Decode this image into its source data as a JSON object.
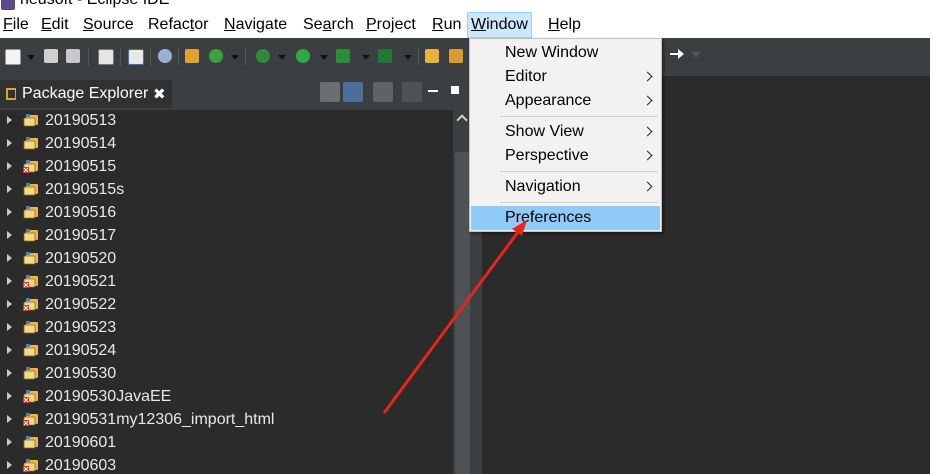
{
  "window": {
    "title": "neusoft - Eclipse IDE"
  },
  "menubar": {
    "items": [
      {
        "label": "File",
        "mnemonic": "F",
        "rest": "ile"
      },
      {
        "label": "Edit",
        "mnemonic": "E",
        "rest": "dit"
      },
      {
        "label": "Source",
        "mnemonic": "S",
        "rest": "ource"
      },
      {
        "label": "Refactor",
        "pre": "Refac",
        "mnemonic": "t",
        "rest": "or"
      },
      {
        "label": "Navigate",
        "mnemonic": "N",
        "rest": "avigate"
      },
      {
        "label": "Search",
        "pre": "Se",
        "mnemonic": "a",
        "rest": "rch"
      },
      {
        "label": "Project",
        "mnemonic": "P",
        "rest": "roject"
      },
      {
        "label": "Run",
        "mnemonic": "R",
        "rest": "un"
      },
      {
        "label": "Window",
        "mnemonic": "W",
        "rest": "indow"
      },
      {
        "label": "Help",
        "mnemonic": "H",
        "rest": "elp"
      }
    ],
    "active": "Window"
  },
  "window_menu": {
    "items": [
      {
        "label": "New Window",
        "submenu": false
      },
      {
        "label": "Editor",
        "submenu": true
      },
      {
        "label": "Appearance",
        "submenu": true
      },
      {
        "label": "Show View",
        "submenu": true
      },
      {
        "label": "Perspective",
        "submenu": true
      },
      {
        "label": "Navigation",
        "submenu": true
      },
      {
        "label": "Preferences",
        "submenu": false,
        "highlighted": true
      }
    ]
  },
  "package_explorer": {
    "title": "Package Explorer",
    "close_icon": "close-icon",
    "projects": [
      {
        "name": "20190513",
        "error": false
      },
      {
        "name": "20190514",
        "error": false
      },
      {
        "name": "20190515",
        "error": true
      },
      {
        "name": "20190515s",
        "error": false
      },
      {
        "name": "20190516",
        "error": false
      },
      {
        "name": "20190517",
        "error": false
      },
      {
        "name": "20190520",
        "error": false
      },
      {
        "name": "20190521",
        "error": true
      },
      {
        "name": "20190522",
        "error": true
      },
      {
        "name": "20190523",
        "error": false
      },
      {
        "name": "20190524",
        "error": false
      },
      {
        "name": "20190530",
        "error": false
      },
      {
        "name": "20190530JavaEE",
        "error": true
      },
      {
        "name": "20190531my12306_import_html",
        "error": true
      },
      {
        "name": "20190601",
        "error": false
      },
      {
        "name": "20190603",
        "error": true
      }
    ]
  },
  "colors": {
    "background": "#2b2b2b",
    "menu_highlight": "#91c9f7",
    "active_menubar": "#cce8ff",
    "annotation_arrow": "#e8241c"
  }
}
